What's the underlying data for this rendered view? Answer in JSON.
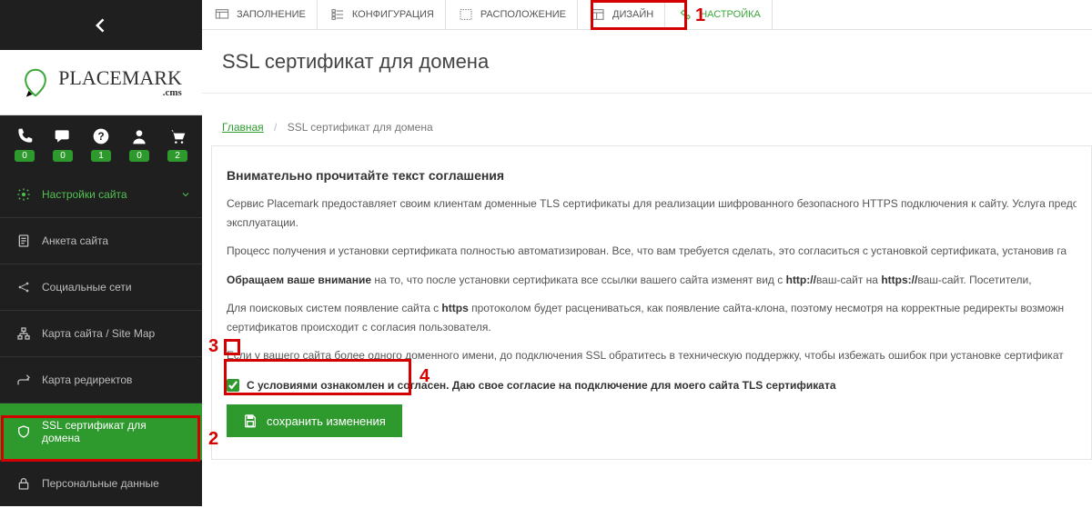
{
  "topTabs": {
    "items": [
      {
        "label": "ЗАПОЛНЕНИЕ"
      },
      {
        "label": "КОНФИГУРАЦИЯ"
      },
      {
        "label": "РАСПОЛОЖЕНИЕ"
      },
      {
        "label": "ДИЗАЙН"
      },
      {
        "label": "НАСТРОЙКА"
      }
    ]
  },
  "logo": {
    "name": "placemark",
    "suffix": ".cms"
  },
  "sideQuick": {
    "items": [
      {
        "count": "0"
      },
      {
        "count": "0"
      },
      {
        "count": "1"
      },
      {
        "count": "0"
      },
      {
        "count": "2"
      }
    ]
  },
  "sideMenu": {
    "items": [
      {
        "label": "Настройки сайта"
      },
      {
        "label": "Анкета сайта"
      },
      {
        "label": "Социальные сети"
      },
      {
        "label": "Карта сайта / Site Map"
      },
      {
        "label": "Карта редиректов"
      },
      {
        "label": "SSL сертификат для домена"
      },
      {
        "label": "Персональные данные"
      }
    ]
  },
  "page": {
    "title": "SSL сертификат для домена",
    "breadcrumb_home": "Главная",
    "breadcrumb_current": "SSL сертификат для домена"
  },
  "content": {
    "heading": "Внимательно прочитайте текст соглашения",
    "p1a": "Сервис Placemark предоставляет своим клиентам доменные TLS сертификаты для реализации шифрованного безопасного HTTPS подключения к сайту. Услуга предо",
    "p1b": "эксплуатации.",
    "p2": "Процесс получения и установки сертификата полностью автоматизирован. Все, что вам требуется сделать, это согласиться с установкой сертификата, установив га",
    "p3_bold": "Обращаем ваше внимание",
    "p3_rest": " на то, что после установки сертификата все ссылки вашего сайта изменят вид с ",
    "p3_http": "http://",
    "p3_mid": "ваш-сайт на ",
    "p3_https": "https://",
    "p3_end": "ваш-сайт. Посетители, ",
    "p4a": "Для поисковых систем появление сайта с ",
    "p4_bold": "https",
    "p4b": " протоколом будет расцениваться, как появление сайта-клона, поэтому несмотря на корректные редиректы возможн",
    "p4c": "сертификатов происходит с согласия пользователя.",
    "p5": "Если у вашего сайта более одного доменного имени, до подключения SSL обратитесь в техническую поддержку, чтобы избежать ошибок при установке сертификат",
    "consent_label": "С условиями ознакомлен и согласен. Даю свое согласие на подключение для моего сайта TLS сертификата",
    "save_label": "сохранить изменения"
  },
  "annotations": {
    "n1": "1",
    "n2": "2",
    "n3": "3",
    "n4": "4"
  }
}
